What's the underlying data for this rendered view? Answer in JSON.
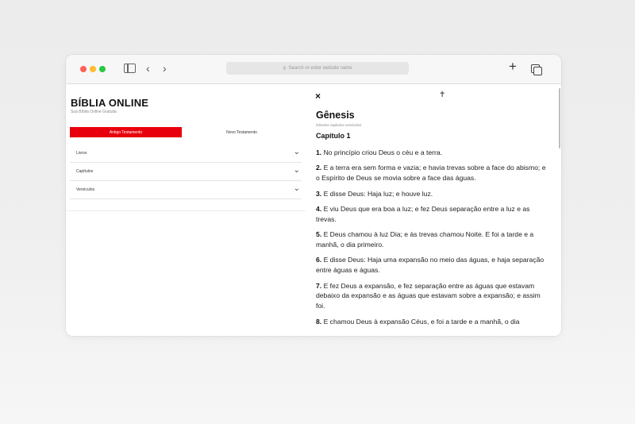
{
  "browser": {
    "address_placeholder": "Search or enter website name",
    "search_glyph": "⚲",
    "back_glyph": "‹",
    "forward_glyph": "›",
    "plus_glyph": "+"
  },
  "sidebar": {
    "title": "BÍBLIA ONLINE",
    "subtitle": "Sua Bíblia Online Gratuita",
    "tabs": [
      {
        "label": "Antigo Testamento",
        "active": true
      },
      {
        "label": "Novo Testamento",
        "active": false
      }
    ],
    "dropdowns": [
      {
        "label": "Livros"
      },
      {
        "label": "Capítulos"
      },
      {
        "label": "Versículos"
      }
    ],
    "chevron_glyph": "⌄"
  },
  "reader": {
    "close_glyph": "×",
    "cross_glyph": "✝",
    "book": "Gênesis",
    "book_sub": "Gênesis capítulos versículos",
    "chapter": "Capítulo 1",
    "verses": [
      {
        "num": "1.",
        "text": "No princípio criou Deus o céu e a terra."
      },
      {
        "num": "2.",
        "text": "E a terra era sem forma e vazia; e havia trevas sobre a face do abismo; e o Espírito de Deus se movia sobre a face das águas."
      },
      {
        "num": "3.",
        "text": "E disse Deus: Haja luz; e houve luz."
      },
      {
        "num": "4.",
        "text": "E viu Deus que era boa a luz; e fez Deus separação entre a luz e as trevas."
      },
      {
        "num": "5.",
        "text": "E Deus chamou à luz Dia; e às trevas chamou Noite. E foi a tarde e a manhã, o dia primeiro."
      },
      {
        "num": "6.",
        "text": "E disse Deus: Haja uma expansão no meio das águas, e haja separação entre águas e águas."
      },
      {
        "num": "7.",
        "text": "E fez Deus a expansão, e fez separação entre as águas que estavam debaixo da expansão e as águas que estavam sobre a expansão; e assim foi."
      },
      {
        "num": "8.",
        "text": "E chamou Deus à expansão Céus, e foi a tarde e a manhã, o dia"
      }
    ]
  },
  "colors": {
    "accent": "#e8000d",
    "traffic_red": "#ff5f57",
    "traffic_yellow": "#febc2e",
    "traffic_green": "#28c840"
  }
}
